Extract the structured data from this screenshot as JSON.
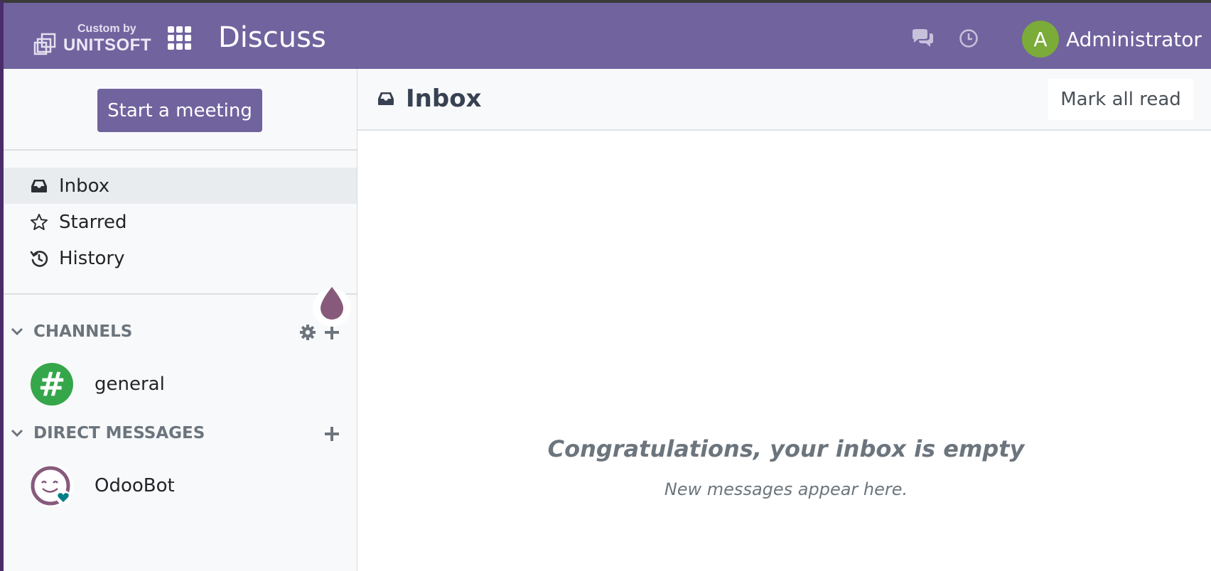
{
  "navbar": {
    "brand_custom": "Custom by",
    "brand_name": "UNITSOFT",
    "app_title": "Discuss",
    "user_initial": "A",
    "user_name": "Administrator",
    "color": "#71639e"
  },
  "sidebar": {
    "start_meeting_label": "Start a meeting",
    "mailboxes": [
      {
        "label": "Inbox",
        "icon": "inbox-icon",
        "active": true
      },
      {
        "label": "Starred",
        "icon": "star-icon",
        "active": false
      },
      {
        "label": "History",
        "icon": "history-icon",
        "active": false
      }
    ],
    "channels": {
      "header": "CHANNELS",
      "items": [
        {
          "label": "general",
          "icon": "hash-icon",
          "color": "#35a64a"
        }
      ]
    },
    "direct_messages": {
      "header": "DIRECT MESSAGES",
      "items": [
        {
          "label": "OdooBot",
          "icon": "odoobot-avatar"
        }
      ]
    }
  },
  "main": {
    "title": "Inbox",
    "mark_all_read_label": "Mark all read",
    "empty_title": "Congratulations, your inbox is empty",
    "empty_subtitle": "New messages appear here."
  }
}
